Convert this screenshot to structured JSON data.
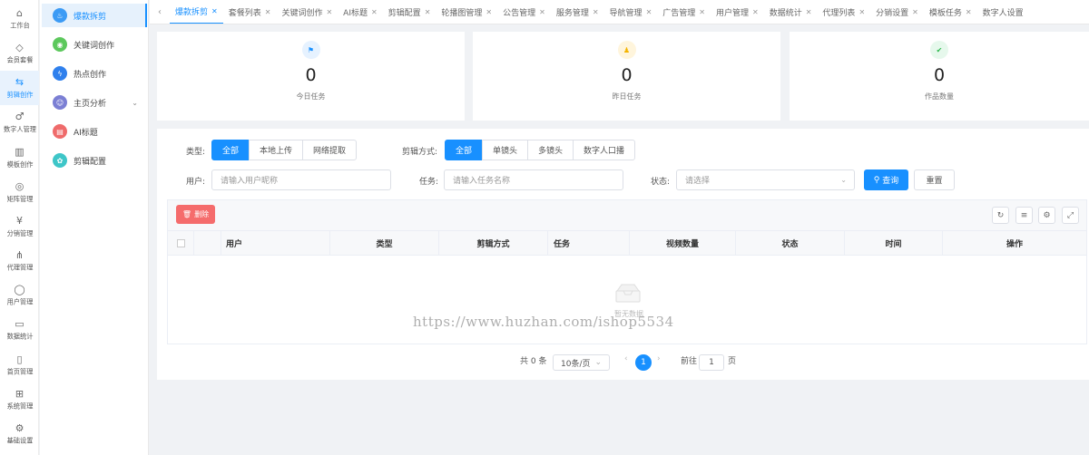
{
  "rail": [
    {
      "label": "工作台",
      "icon": "home-icon",
      "glyph": "⌂"
    },
    {
      "label": "会员套餐",
      "icon": "drop-icon",
      "glyph": "◇"
    },
    {
      "label": "剪辑创作",
      "icon": "edit-flow-icon",
      "glyph": "⇆"
    },
    {
      "label": "数字人管理",
      "icon": "digital-human-icon",
      "glyph": "♂"
    },
    {
      "label": "模板创作",
      "icon": "template-icon",
      "glyph": "▥"
    },
    {
      "label": "矩阵管理",
      "icon": "chat-icon",
      "glyph": "◎"
    },
    {
      "label": "分销管理",
      "icon": "yen-icon",
      "glyph": "¥"
    },
    {
      "label": "代理管理",
      "icon": "network-icon",
      "glyph": "⋔"
    },
    {
      "label": "用户管理",
      "icon": "user-icon",
      "glyph": "◯"
    },
    {
      "label": "数据统计",
      "icon": "chart-icon",
      "glyph": "▭"
    },
    {
      "label": "首页管理",
      "icon": "phone-icon",
      "glyph": "▯"
    },
    {
      "label": "系统管理",
      "icon": "grid-icon",
      "glyph": "⊞"
    },
    {
      "label": "基础设置",
      "icon": "gears-icon",
      "glyph": "⚙"
    }
  ],
  "submenu": [
    {
      "label": "爆款拆剪",
      "icon": "flame-icon",
      "glyph": "♨",
      "color": "#3c9bf5"
    },
    {
      "label": "关键词创作",
      "icon": "target-icon",
      "glyph": "◉",
      "color": "#5cc85c"
    },
    {
      "label": "热点创作",
      "icon": "bolt-icon",
      "glyph": "ϟ",
      "color": "#2f80ed"
    },
    {
      "label": "主页分析",
      "icon": "user-circle-icon",
      "glyph": "☺",
      "color": "#7b7fd4",
      "chevron": "⌄"
    },
    {
      "label": "AI标题",
      "icon": "doc-icon",
      "glyph": "▤",
      "color": "#ef6b6b"
    },
    {
      "label": "剪辑配置",
      "icon": "gear-icon",
      "glyph": "✿",
      "color": "#3ec6c8"
    }
  ],
  "tabs": {
    "prev": "‹",
    "close": "✕",
    "items": [
      "爆款拆剪",
      "套餐列表",
      "关键词创作",
      "AI标题",
      "剪辑配置",
      "轮播图管理",
      "公告管理",
      "服务管理",
      "导航管理",
      "广告管理",
      "用户管理",
      "数据统计",
      "代理列表",
      "分销设置",
      "模板任务",
      "数字人设置"
    ]
  },
  "stats": [
    {
      "value": "0",
      "label": "今日任务",
      "icon": "flag-icon",
      "glyph": "⚑",
      "bg": "#e6f2ff",
      "fg": "#1890ff"
    },
    {
      "value": "0",
      "label": "昨日任务",
      "icon": "person-icon",
      "glyph": "♟",
      "bg": "#fff5dc",
      "fg": "#f4b400"
    },
    {
      "value": "0",
      "label": "作品数量",
      "icon": "check-icon",
      "glyph": "✔",
      "bg": "#e6f8ec",
      "fg": "#2db84d"
    }
  ],
  "filters": {
    "type_label": "类型:",
    "type_options": [
      "全部",
      "本地上传",
      "网络提取"
    ],
    "edit_label": "剪辑方式:",
    "edit_options": [
      "全部",
      "单镜头",
      "多镜头",
      "数字人口播"
    ],
    "user_label": "用户:",
    "user_placeholder": "请输入用户昵称",
    "task_label": "任务:",
    "task_placeholder": "请输入任务名称",
    "status_label": "状态:",
    "status_placeholder": "请选择",
    "query_label": "查询",
    "reset_label": "重置"
  },
  "toolbar": {
    "delete_label": "删除"
  },
  "table": {
    "columns": [
      "用户",
      "类型",
      "剪辑方式",
      "任务",
      "视频数量",
      "状态",
      "时间",
      "操作"
    ],
    "empty_text": "暂无数据"
  },
  "watermark": "https://www.huzhan.com/ishop5534",
  "pagination": {
    "total": "共 0 条",
    "page_size": "10条/页",
    "current": "1",
    "goto_label": "前往",
    "goto_value": "1",
    "page_unit": "页"
  }
}
